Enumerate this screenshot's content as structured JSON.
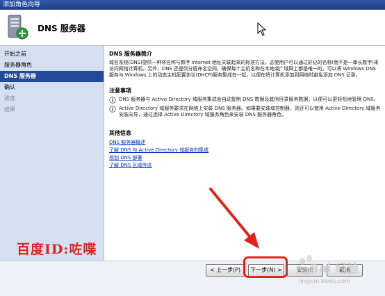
{
  "window": {
    "title": "添加角色向导"
  },
  "header": {
    "title": "DNS 服务器"
  },
  "sidebar": {
    "items": [
      {
        "label": "开始之前",
        "state": "normal"
      },
      {
        "label": "服务器角色",
        "state": "normal"
      },
      {
        "label": "DNS 服务器",
        "state": "active"
      },
      {
        "label": "确认",
        "state": "normal"
      },
      {
        "label": "进度",
        "state": "disabled"
      },
      {
        "label": "结果",
        "state": "disabled"
      }
    ]
  },
  "content": {
    "intro_title": "DNS 服务器简介",
    "intro_text": "域名系统(DNS)提供一种将名称与数字 Internet 地址关联起来的标准方法。这使用户可以通过好记的名称(而不是一串长数字)来访问网络计算机。另外，DNS 还提供分层命名空间，确保每个主机名称在本地或广域网上都是唯一的。可以将 Windows DNS 服务与 Windows 上的动态主机配置协议(DHCP)服务集成在一起，以便在将计算机添加到网络时避免添加 DNS 记录。",
    "notes_title": "注意事项",
    "notes": [
      "DNS 服务器与 Active Directory 域服务集成会自动复制 DNS 数据及其他目录服务数据，以便可以更轻松地管理 DNS。",
      "Active Directory 域服务要求在网络上安装 DNS 服务器。如果要安装域控制器，则还可以使用 Active Directory 域服务安装向导，通过选择 Active Directory 域服务角色来安装 DNS 服务器角色。"
    ],
    "more_title": "其他信息",
    "links": [
      "DNS 服务器概述",
      "了解 DNS 与 Active Directory 域服务的集成",
      "规划 DNS 部署",
      "了解 DNS 区域传送"
    ]
  },
  "footer": {
    "prev_label": "< 上一步(P)",
    "next_label": "下一步(N) >",
    "install_label": "安装(I)",
    "cancel_label": "取消"
  },
  "overlay": {
    "author_watermark": "百度ID:咗喋",
    "brand_watermark": "Bai 经验",
    "brand_url": "jingyan.baidu.com"
  },
  "colors": {
    "sidebar_bg": "#d4e0f2",
    "active_item": "#234b9a",
    "annotation_red": "#e2231a",
    "link_blue": "#0033cc"
  }
}
